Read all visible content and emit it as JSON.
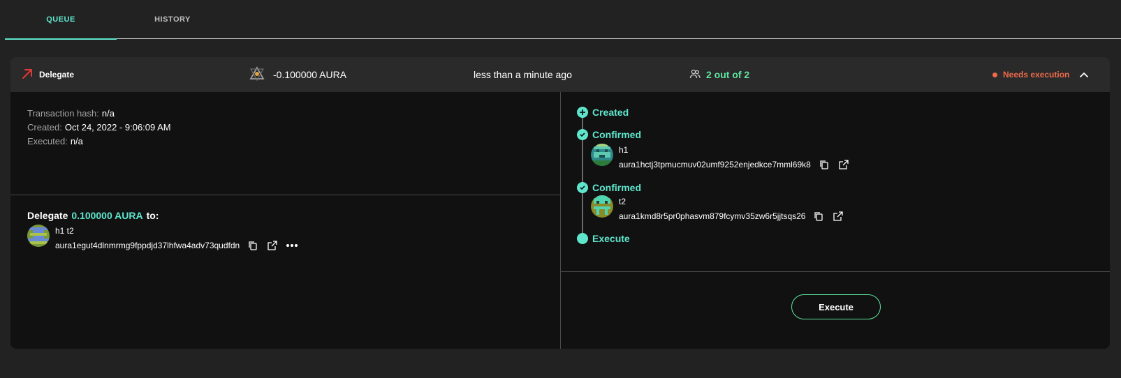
{
  "tabs": [
    {
      "label": "QUEUE",
      "active": true
    },
    {
      "label": "HISTORY",
      "active": false
    }
  ],
  "transaction": {
    "type": "Delegate",
    "type_icon": "arrow-up-right-icon",
    "amount": "-0.100000 AURA",
    "time": "less than a minute ago",
    "signers": "2 out of 2",
    "status": "Needs execution",
    "colors": {
      "accent": "#5ee6cd",
      "signers": "#5ee6a0",
      "status": "#f06a4a",
      "arrow": "#e53935"
    }
  },
  "details": {
    "hash_label": "Transaction hash:",
    "hash_value": "n/a",
    "created_label": "Created:",
    "created_value": "Oct 24, 2022 - 9:06:09 AM",
    "executed_label": "Executed:",
    "executed_value": "n/a"
  },
  "delegation": {
    "prefix": "Delegate",
    "amount": "0.100000 AURA",
    "suffix": "to:",
    "validator_name": "h1 t2",
    "validator_address": "aura1egut4dlnmrmg9fppdjd37lhfwa4adv73qudfdn"
  },
  "timeline": {
    "created": "Created",
    "confirmed_1": "Confirmed",
    "signer_1_name": "h1",
    "signer_1_address": "aura1hctj3tpmucmuv02umf9252enjedkce7mml69k8",
    "confirmed_2": "Confirmed",
    "signer_2_name": "t2",
    "signer_2_address": "aura1kmd8r5pr0phasvm879fcymv35zw6r5jjtsqs26",
    "execute": "Execute"
  },
  "execute_button": "Execute"
}
